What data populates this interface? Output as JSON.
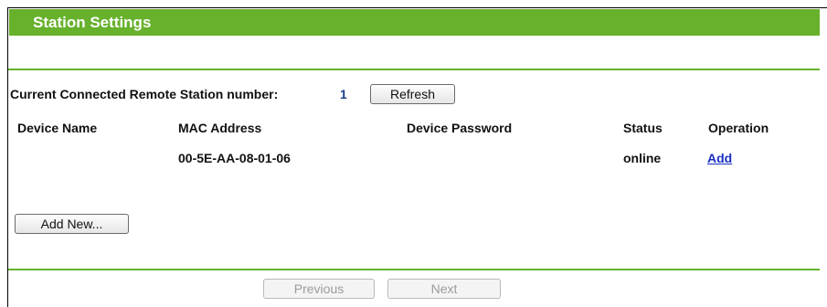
{
  "page": {
    "title": "Station Settings"
  },
  "summary": {
    "label": "Current Connected Remote Station number:",
    "count": "1",
    "refresh_label": "Refresh"
  },
  "table": {
    "headers": [
      "Device Name",
      "MAC Address",
      "Device Password",
      "Status",
      "Operation"
    ],
    "rows": [
      {
        "device_name": "",
        "mac_address": "00-5E-AA-08-01-06",
        "device_password": "",
        "status": "online",
        "operation": "Add"
      }
    ]
  },
  "actions": {
    "add_new_label": "Add New..."
  },
  "pagination": {
    "previous_label": "Previous",
    "next_label": "Next"
  },
  "colors": {
    "accent": "#67b12c",
    "link": "#1a2fc4",
    "count": "#1a3c8c"
  }
}
